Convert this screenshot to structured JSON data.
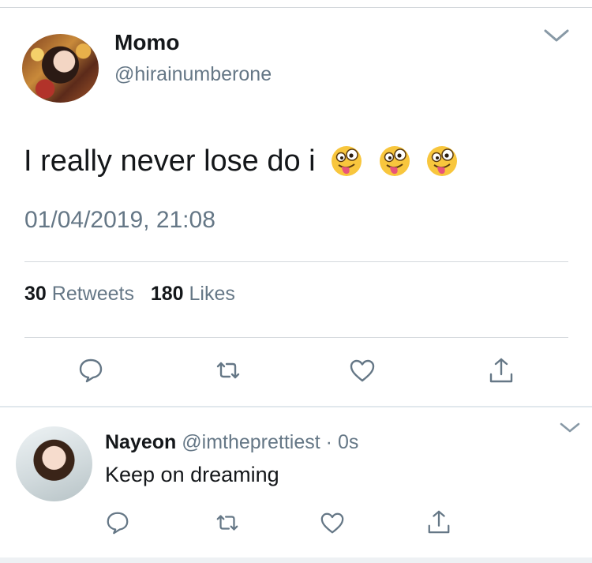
{
  "tweet": {
    "author_name": "Momo",
    "author_handle": "@hirainumberone",
    "text": "I really never lose do i",
    "emojis": [
      "zany-face",
      "zany-face",
      "zany-face"
    ],
    "timestamp": "01/04/2019, 21:08",
    "retweet_count": "30",
    "retweet_label": "Retweets",
    "like_count": "180",
    "like_label": "Likes"
  },
  "reply": {
    "author_name": "Nayeon",
    "author_handle": "@imtheprettiest",
    "separator": "·",
    "time": "0s",
    "text": "Keep on dreaming"
  },
  "colors": {
    "text_primary": "#14171a",
    "text_secondary": "#657786",
    "icon": "#657786",
    "divider": "#d4d8dc"
  }
}
